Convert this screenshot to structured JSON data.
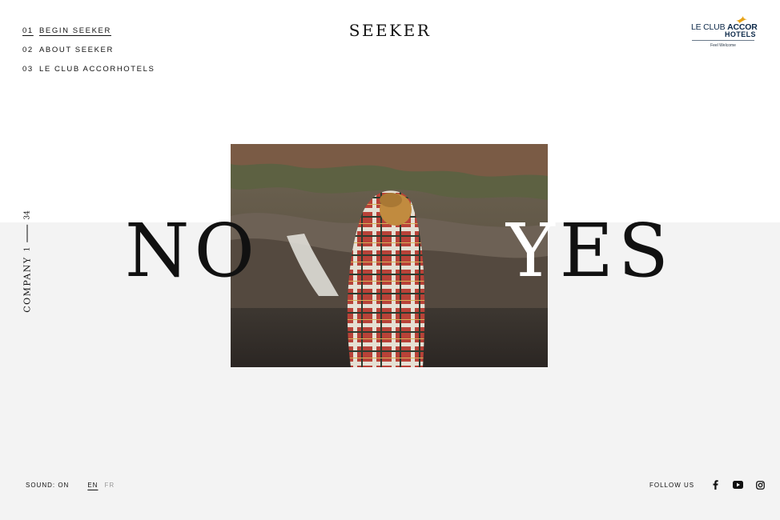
{
  "nav": {
    "items": [
      {
        "num": "01",
        "label": "BEGIN SEEKER"
      },
      {
        "num": "02",
        "label": "ABOUT SEEKER"
      },
      {
        "num": "03",
        "label": "LE CLUB ACCORHOTELS"
      }
    ]
  },
  "brand": {
    "title": "SEEKER"
  },
  "partner": {
    "line1_a": "LE CLUB ",
    "line1_b": "ACCOR",
    "line2": "HOTELS",
    "tagline": "Feel Welcome",
    "accent": "#e8a317",
    "navy": "#0e2a4a"
  },
  "counter": {
    "label": "COMPANY",
    "current": "1",
    "total": "34"
  },
  "hero": {
    "no": "NO",
    "yes_on_photo": "Y",
    "yes_rest": "ES",
    "photo_icon": "person-in-plaid-blanket-waterfall-photo"
  },
  "footer": {
    "sound": "SOUND: ON",
    "lang_en": "EN",
    "lang_fr": "FR",
    "follow": "FOLLOW US",
    "icons": [
      "facebook-icon",
      "youtube-icon",
      "instagram-icon"
    ]
  }
}
